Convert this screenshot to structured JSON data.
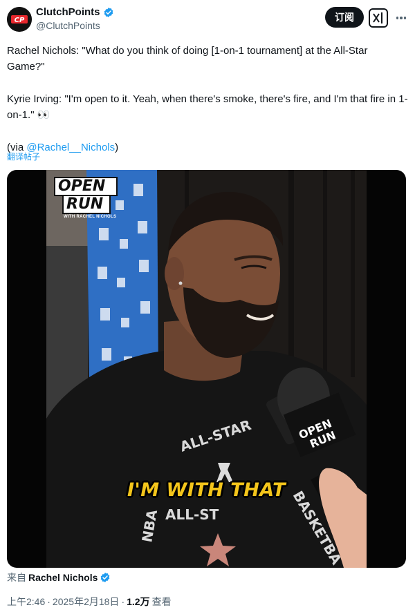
{
  "author": {
    "display_name": "ClutchPoints",
    "handle": "@ClutchPoints",
    "avatar_text": "CP",
    "verified_icon": "verified-badge-icon"
  },
  "header_actions": {
    "subscribe_label": "订阅",
    "grok_icon": "grok-icon",
    "more_icon": "more-horizontal-icon"
  },
  "tweet": {
    "paragraph_1": "Rachel Nichols: \"What do you think of doing [1-on-1 tournament] at the All-Star Game?\"",
    "paragraph_2": "Kyrie Irving: \"I'm open to it. Yeah, when there's smoke, there's fire, and I'm that fire in 1-on-1.\" 👀",
    "via_prefix": "(via ",
    "via_mention": "@Rachel__Nichols",
    "via_suffix": ")",
    "translate_label": "翻译帖子"
  },
  "media": {
    "logo_line_1": "OPEN",
    "logo_line_2": "RUN",
    "logo_sub": "WITH RACHEL NICHOLS",
    "caption": "I'M WITH THAT",
    "shirt_text_top": "ALL-STAR",
    "shirt_text_bottom": "ALL-ST",
    "shirt_text_right": "BASKETBA",
    "shirt_text_left": "NBA"
  },
  "source": {
    "prefix": "来自",
    "name": "Rachel Nichols"
  },
  "meta": {
    "time": "上午2:46",
    "sep1": "·",
    "date": "2025年2月18日",
    "sep2": "·",
    "views_count": "1.2万",
    "views_label": "查看"
  },
  "colors": {
    "text_primary": "#0f1419",
    "text_secondary": "#536471",
    "link": "#1d9bf0",
    "caption_yellow": "#f3c51b"
  }
}
